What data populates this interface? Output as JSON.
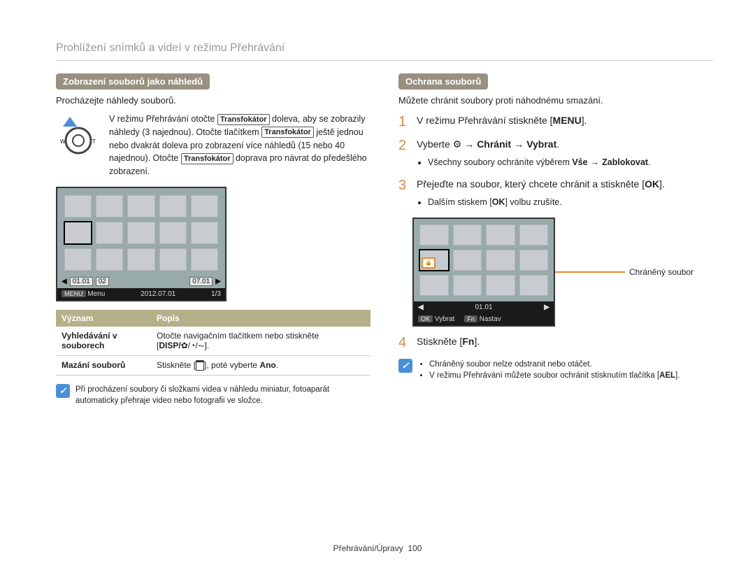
{
  "page_title": "Prohlížení snímků a videí v režimu Přehrávání",
  "left": {
    "heading": "Zobrazení souborů jako náhledů",
    "intro": "Procházejte náhledy souborů.",
    "zoom_pre": "V režimu Přehrávání otočte ",
    "zoom_btn1": "Transfokátor",
    "zoom_mid1": " doleva, aby se zobrazily náhledy (3 najednou). Otočte tlačítkem ",
    "zoom_btn2": "Transfokátor",
    "zoom_mid2": " ještě jednou nebo dvakrát doleva pro zobrazení více náhledů (15 nebo 40 najednou). Otočte ",
    "zoom_btn3": "Transfokátor",
    "zoom_end": " doprava pro návrat do předešlého zobrazení.",
    "shot": {
      "d1": "01.01",
      "d2": "02",
      "d3": "07.01",
      "menu_btn": "MENU",
      "menu": "Menu",
      "date": "2012.07.01",
      "page": "1/3"
    },
    "table": {
      "h1": "Význam",
      "h2": "Popis",
      "r1c1a": "Vyhledávání v",
      "r1c1b": "souborech",
      "r1c2a": "Otočte navigačním tlačítkem nebo stiskněte",
      "r1c2b_pre": "[",
      "r1c2b_kbd": "DISP/",
      "r1c2b_post": "].",
      "r2c1": "Mazání souborů",
      "r2c2_pre": "Stiskněte [",
      "r2c2_post": "], poté vyberte ",
      "r2c2_b": "Ano",
      "r2c2_end": "."
    },
    "note": "Při procházení soubory či složkami videa v náhledu miniatur, fotoaparát automaticky přehraje video nebo fotografii ve složce."
  },
  "right": {
    "heading": "Ochrana souborů",
    "intro": "Můžete chránit soubory proti náhodnému smazání.",
    "steps": {
      "s1": {
        "n": "1",
        "pre": "V režimu Přehrávání stiskněte [",
        "btn": "MENU",
        "post": "]."
      },
      "s2": {
        "n": "2",
        "pre": "Vyberte ",
        "icon_name": "gear-icon",
        "seg1": "Chránit",
        "seg2": "Vybrat",
        "post": ".",
        "bullet_pre": "Všechny soubory ochráníte výběrem ",
        "b1": "Vše",
        "b2": "Zablokovat",
        "bullet_post": "."
      },
      "s3": {
        "n": "3",
        "pre": "Přejeďte na soubor, který chcete chránit a stiskněte [",
        "btn": "OK",
        "post": "].",
        "bullet_pre": "Dalším stiskem [",
        "bullet_btn": "OK",
        "bullet_post": "] volbu zrušíte."
      },
      "s4": {
        "n": "4",
        "pre": "Stiskněte [",
        "btn": "Fn",
        "post": "]."
      }
    },
    "callout": "Chráněný soubor",
    "shot": {
      "date": "01.01",
      "ok": "OK",
      "ok_lbl": "Vybrat",
      "fn": "Fn",
      "fn_lbl": "Nastav"
    },
    "note_items": {
      "i1": "Chráněný soubor nelze odstranit nebo otáčet.",
      "i2_pre": "V režimu Přehrávání můžete soubor ochránit stisknutím tlačítka [",
      "i2_btn": "AEL",
      "i2_post": "]."
    }
  },
  "footer_label": "Přehrávání/Úpravy",
  "footer_page": "100"
}
